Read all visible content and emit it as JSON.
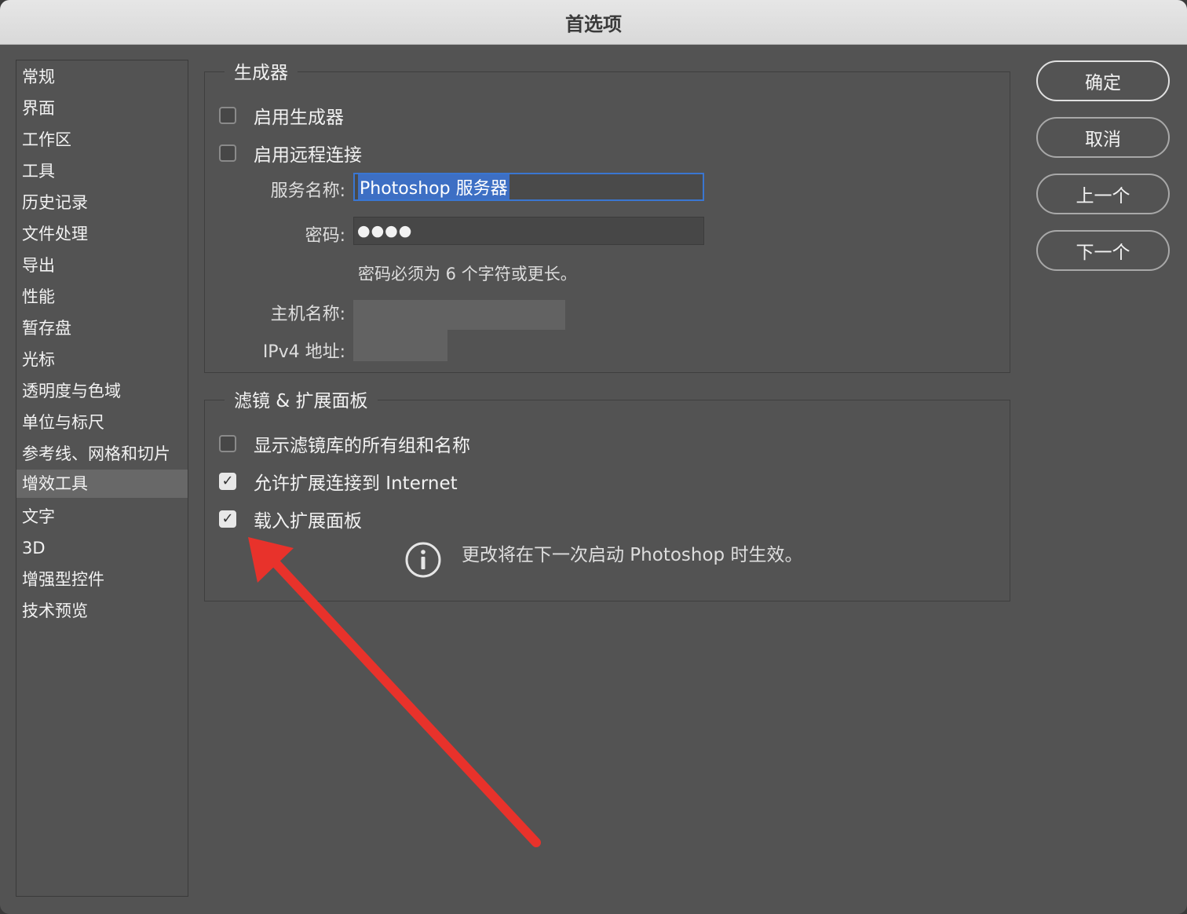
{
  "window": {
    "title": "首选项"
  },
  "sidebar": {
    "items": [
      {
        "label": "常规"
      },
      {
        "label": "界面"
      },
      {
        "label": "工作区"
      },
      {
        "label": "工具"
      },
      {
        "label": "历史记录"
      },
      {
        "label": "文件处理"
      },
      {
        "label": "导出"
      },
      {
        "label": "性能"
      },
      {
        "label": "暂存盘"
      },
      {
        "label": "光标"
      },
      {
        "label": "透明度与色域"
      },
      {
        "label": "单位与标尺"
      },
      {
        "label": "参考线、网格和切片"
      },
      {
        "label": "增效工具"
      },
      {
        "label": "文字"
      },
      {
        "label": "3D"
      },
      {
        "label": "增强型控件"
      },
      {
        "label": "技术预览"
      }
    ],
    "selected": "增效工具"
  },
  "generator": {
    "title": "生成器",
    "enable_generator": {
      "label": "启用生成器",
      "checked": false
    },
    "enable_remote": {
      "label": "启用远程连接",
      "checked": false
    },
    "service_name_label": "服务名称:",
    "service_name_value": "Photoshop 服务器",
    "password_label": "密码:",
    "password_value": "●●●●",
    "password_hint": "密码必须为 6 个字符或更长。",
    "hostname_label": "主机名称:",
    "ipv4_label": "IPv4 地址:"
  },
  "filters": {
    "title": "滤镜 & 扩展面板",
    "show_all_groups": {
      "label": "显示滤镜库的所有组和名称",
      "checked": false
    },
    "allow_extensions_internet": {
      "label": "允许扩展连接到 Internet",
      "checked": true
    },
    "load_extension_panels": {
      "label": "载入扩展面板",
      "checked": true
    },
    "restart_notice": "更改将在下一次启动 Photoshop 时生效。"
  },
  "buttons": {
    "ok": "确定",
    "cancel": "取消",
    "prev": "上一个",
    "next": "下一个"
  },
  "annotation": {
    "arrow_color": "#e8322b"
  }
}
